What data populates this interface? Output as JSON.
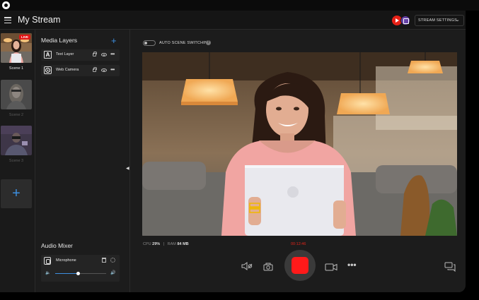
{
  "header": {
    "title": "My Stream",
    "stream_settings_label": "STREAM SETTINGS"
  },
  "scenes": [
    {
      "label": "Scene 1",
      "live": true,
      "live_label": "LIVE"
    },
    {
      "label": "Scene 2",
      "live": false
    },
    {
      "label": "Scene 3",
      "live": false
    }
  ],
  "media_layers": {
    "title": "Media Layers",
    "items": [
      {
        "name": "Text Layer",
        "icon": "text-layer-icon"
      },
      {
        "name": "Web Camera",
        "icon": "webcam-icon"
      }
    ]
  },
  "audio_mixer": {
    "title": "Audio Mixer",
    "items": [
      {
        "name": "Microphone",
        "volume": 0.45
      }
    ]
  },
  "main": {
    "auto_scene_switching_label": "AUTO SCENE SWITCHING",
    "auto_scene_switching_enabled": false,
    "help_glyph": "?",
    "stats": {
      "cpu_label": "CPU",
      "cpu_value": "29%",
      "separator": "|",
      "ram_label": "RAM",
      "ram_value": "84 MB"
    },
    "timer": "00:12:46"
  },
  "colors": {
    "accent": "#3d8fe0",
    "record": "#ff1a1a",
    "live": "#e01515",
    "youtube": "#e62117",
    "twitch": "#6441a5"
  },
  "icons": {
    "menu": "hamburger-icon",
    "add": "plus-icon",
    "lock": "lock-icon",
    "visibility": "eye-icon",
    "more": "more-icon",
    "delete": "trash-icon",
    "settings": "gear-icon",
    "mute": "mute-speaker-icon",
    "snapshot": "camera-icon",
    "record": "record-icon",
    "video": "video-camera-icon",
    "chat": "chat-icon"
  }
}
